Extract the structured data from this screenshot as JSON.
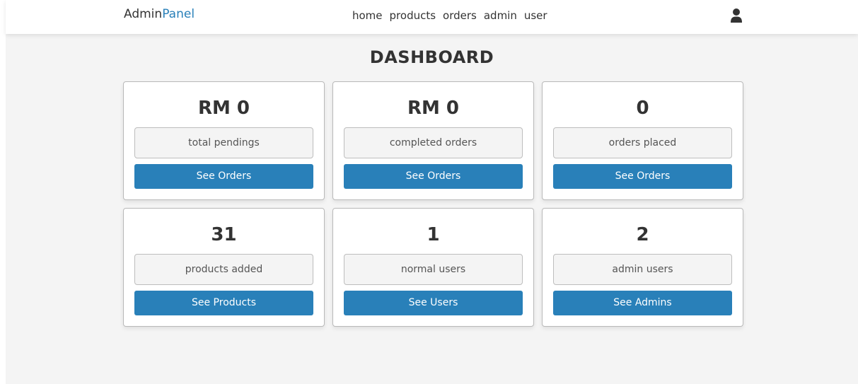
{
  "header": {
    "logo_main": "Admin",
    "logo_accent": "Panel",
    "nav": [
      "home",
      "products",
      "orders",
      "admin",
      "user"
    ],
    "user_icon": "user-icon"
  },
  "page": {
    "title": "DASHBOARD"
  },
  "cards": [
    {
      "value": "RM 0",
      "label": "total pendings",
      "button": "See Orders"
    },
    {
      "value": "RM 0",
      "label": "completed orders",
      "button": "See Orders"
    },
    {
      "value": "0",
      "label": "orders placed",
      "button": "See Orders"
    },
    {
      "value": "31",
      "label": "products added",
      "button": "See Products"
    },
    {
      "value": "1",
      "label": "normal users",
      "button": "See Users"
    },
    {
      "value": "2",
      "label": "admin users",
      "button": "See Admins"
    }
  ],
  "colors": {
    "accent": "#2980b9",
    "background": "#f4f4f4"
  }
}
